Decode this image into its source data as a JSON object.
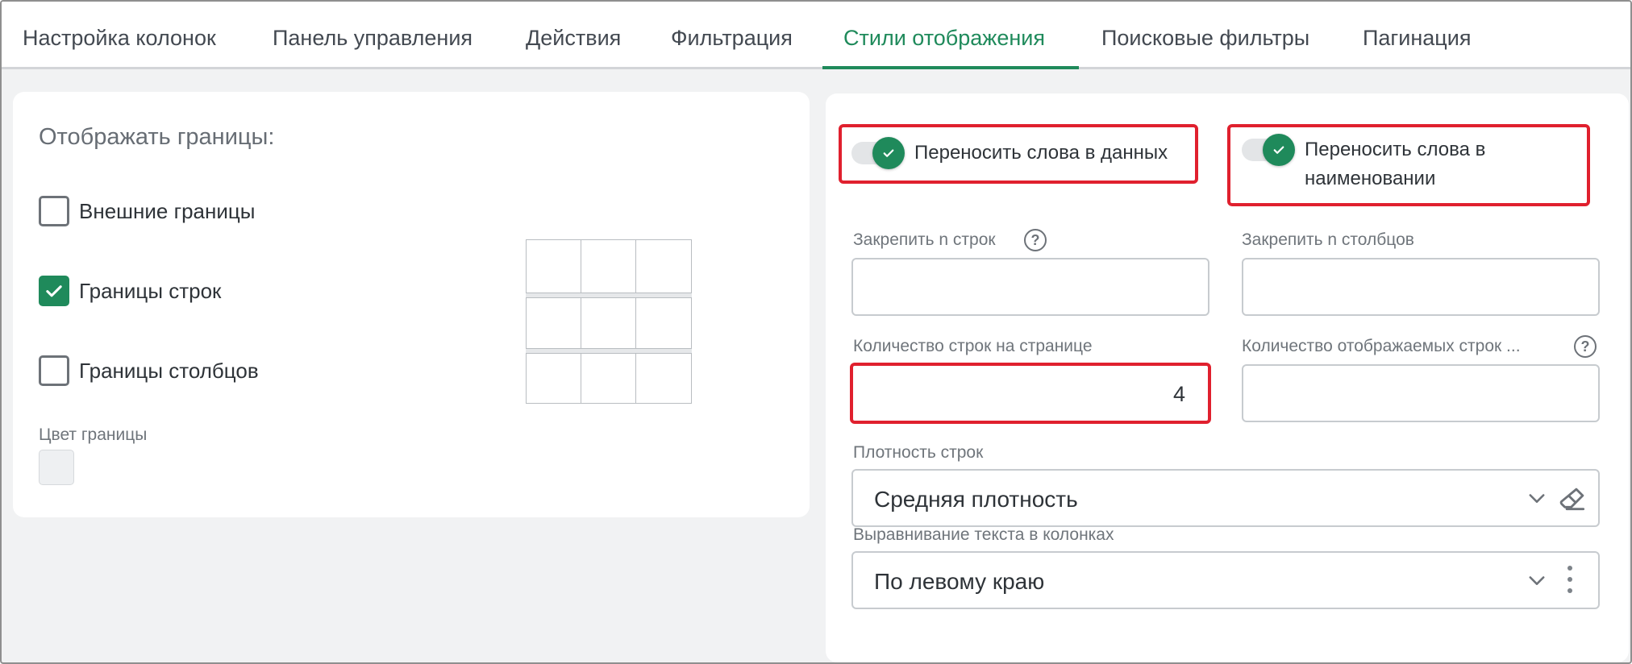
{
  "tabs": [
    {
      "label": "Настройка колонок",
      "active": false
    },
    {
      "label": "Панель управления",
      "active": false
    },
    {
      "label": "Действия",
      "active": false
    },
    {
      "label": "Фильтрация",
      "active": false
    },
    {
      "label": "Стили отображения",
      "active": true
    },
    {
      "label": "Поисковые фильтры",
      "active": false
    },
    {
      "label": "Пагинация",
      "active": false
    }
  ],
  "borders": {
    "title": "Отображать границы:",
    "outer": {
      "label": "Внешние границы",
      "checked": false
    },
    "rows": {
      "label": "Границы строк",
      "checked": true
    },
    "columns": {
      "label": "Границы столбцов",
      "checked": false
    },
    "color_label": "Цвет границы",
    "color_value": "#eef0f2"
  },
  "toggles": {
    "wrap_data": {
      "label": "Переносить слова в данных",
      "on": true
    },
    "wrap_header": {
      "label_line1": "Переносить слова в",
      "label_line2": "наименовании",
      "on": true
    }
  },
  "fields": {
    "freeze_rows": {
      "label": "Закрепить n строк",
      "value": ""
    },
    "freeze_cols": {
      "label": "Закрепить n столбцов",
      "value": ""
    },
    "rows_per_page": {
      "label": "Количество строк на странице",
      "value": "4"
    },
    "visible_rows": {
      "label": "Количество отображаемых строк ...",
      "value": ""
    },
    "density": {
      "label": "Плотность строк",
      "value": "Средняя плотность"
    },
    "align": {
      "label": "Выравнивание текста в колонках",
      "value": "По левому краю"
    }
  },
  "colors": {
    "accent": "#1f8a5b",
    "highlight": "#e0202e"
  }
}
